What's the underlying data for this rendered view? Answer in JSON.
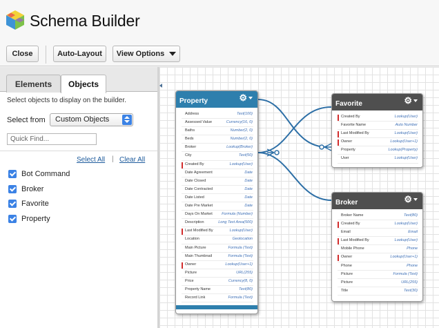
{
  "app": {
    "title": "Schema Builder"
  },
  "toolbar": {
    "close_label": "Close",
    "auto_layout_label": "Auto-Layout",
    "view_options_label": "View Options"
  },
  "sidebar": {
    "tabs": [
      {
        "label": "Elements",
        "active": false
      },
      {
        "label": "Objects",
        "active": true
      }
    ],
    "description": "Select objects to display on the builder.",
    "select_from_label": "Select from",
    "select_from_value": "Custom Objects",
    "quick_find_placeholder": "Quick Find...",
    "select_all_label": "Select All",
    "separator": "|",
    "clear_all_label": "Clear All",
    "objects": [
      {
        "label": "Bot Command",
        "checked": true
      },
      {
        "label": "Broker",
        "checked": true
      },
      {
        "label": "Favorite",
        "checked": true
      },
      {
        "label": "Property",
        "checked": true
      }
    ]
  },
  "colors": {
    "property_header": "#2e7fad",
    "object_header": "#4f4f4f",
    "required_marker": "#d22b2b",
    "connector": "#2d6fa6",
    "checkbox": "#3b82e5"
  },
  "entities": {
    "property": {
      "name": "Property",
      "fields": [
        {
          "name": "Address",
          "type": "Text(100)",
          "required": false
        },
        {
          "name": "Assessed Value",
          "type": "Currency(16, 0)",
          "required": false
        },
        {
          "name": "Baths",
          "type": "Number(2, 0)",
          "required": false
        },
        {
          "name": "Beds",
          "type": "Number(2, 0)",
          "required": false
        },
        {
          "name": "Broker",
          "type": "Lookup(Broker)",
          "required": false
        },
        {
          "name": "City",
          "type": "Text(50)",
          "required": false
        },
        {
          "name": "Created By",
          "type": "Lookup(User)",
          "required": true
        },
        {
          "name": "Date Agreement",
          "type": "Date",
          "required": false
        },
        {
          "name": "Date Closed",
          "type": "Date",
          "required": false
        },
        {
          "name": "Date Contracted",
          "type": "Date",
          "required": false
        },
        {
          "name": "Date Listed",
          "type": "Date",
          "required": false
        },
        {
          "name": "Date Pre Market",
          "type": "Date",
          "required": false
        },
        {
          "name": "Days On Market",
          "type": "Formula (Number)",
          "required": false
        },
        {
          "name": "Description",
          "type": "Long Text Area(500)",
          "required": false
        },
        {
          "name": "Last Modified By",
          "type": "Lookup(User)",
          "required": true
        },
        {
          "name": "Location",
          "type": "Geolocation",
          "required": false
        },
        {
          "name": "Main Picture",
          "type": "Formula (Text)",
          "required": false
        },
        {
          "name": "Main Thumbnail",
          "type": "Formula (Text)",
          "required": false
        },
        {
          "name": "Owner",
          "type": "Lookup(User+1)",
          "required": true
        },
        {
          "name": "Picture",
          "type": "URL(255)",
          "required": false
        },
        {
          "name": "Price",
          "type": "Currency(8, 0)",
          "required": false
        },
        {
          "name": "Property Name",
          "type": "Text(80)",
          "required": false
        },
        {
          "name": "Record Link",
          "type": "Formula (Text)",
          "required": false
        }
      ]
    },
    "favorite": {
      "name": "Favorite",
      "fields": [
        {
          "name": "Created By",
          "type": "Lookup(User)",
          "required": true
        },
        {
          "name": "Favorite Name",
          "type": "Auto Number",
          "required": false
        },
        {
          "name": "Last Modified By",
          "type": "Lookup(User)",
          "required": true
        },
        {
          "name": "Owner",
          "type": "Lookup(User+1)",
          "required": true
        },
        {
          "name": "Property",
          "type": "Lookup(Property)",
          "required": false
        },
        {
          "name": "User",
          "type": "Lookup(User)",
          "required": false
        }
      ]
    },
    "broker": {
      "name": "Broker",
      "fields": [
        {
          "name": "Broker Name",
          "type": "Text(80)",
          "required": false
        },
        {
          "name": "Created By",
          "type": "Lookup(User)",
          "required": true
        },
        {
          "name": "Email",
          "type": "Email",
          "required": false
        },
        {
          "name": "Last Modified By",
          "type": "Lookup(User)",
          "required": true
        },
        {
          "name": "Mobile Phone",
          "type": "Phone",
          "required": false
        },
        {
          "name": "Owner",
          "type": "Lookup(User+1)",
          "required": true
        },
        {
          "name": "Phone",
          "type": "Phone",
          "required": false
        },
        {
          "name": "Picture",
          "type": "Formula (Text)",
          "required": false
        },
        {
          "name": "Picture",
          "type": "URL(255)",
          "required": false
        },
        {
          "name": "Title",
          "type": "Text(30)",
          "required": false
        }
      ]
    }
  }
}
